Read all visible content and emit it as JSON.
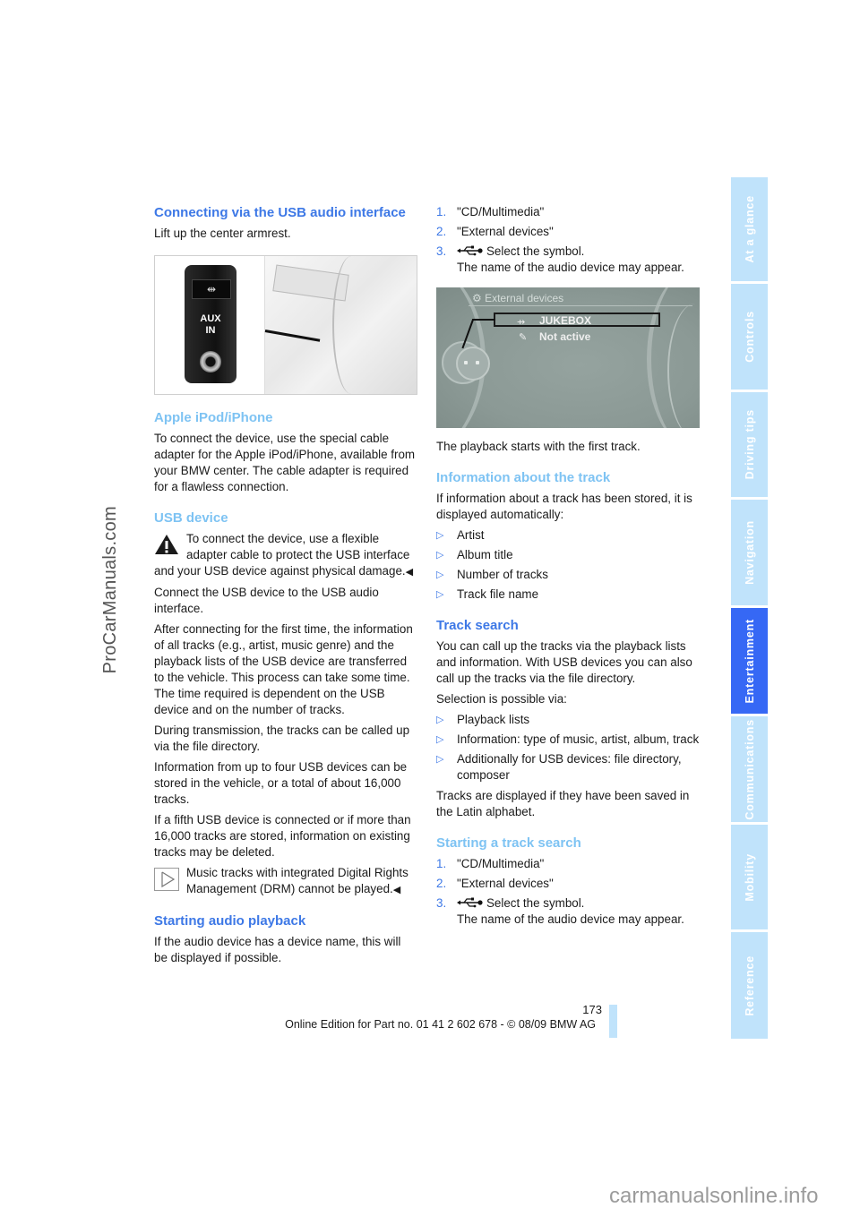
{
  "left_column": {
    "usb_section": {
      "heading": "Connecting via the USB audio interface",
      "intro": "Lift up the center armrest.",
      "figure": {
        "label_line1": "AUX",
        "label_line2": "IN",
        "usb_symbol": "⇹"
      }
    },
    "apple_section": {
      "heading": "Apple iPod/iPhone",
      "body": "To connect the device, use the special cable adapter for the Apple iPod/iPhone, available from your BMW center. The cable adapter is required for a flawless connection."
    },
    "usb_device_section": {
      "heading": "USB device",
      "warning_text": "To connect the device, use a flexible adapter cable to protect the USB interface and your USB device against physical damage.",
      "end_mark": "◀",
      "para1": "Connect the USB device to the USB audio interface.",
      "para2": "After connecting for the first time, the information of all tracks (e.g., artist, music genre) and the playback lists of the USB device are transferred to the vehicle. This process can take some time. The time required is dependent on the USB device and on the number of tracks.",
      "para3": "During transmission, the tracks can be called up via the file directory.",
      "para4": "Information from up to four USB devices can be stored in the vehicle, or a total of about 16,000 tracks.",
      "para5": "If a fifth USB device is connected or if more than 16,000 tracks are stored, information on existing tracks may be deleted.",
      "note_text": "Music tracks with integrated Digital Rights Management (DRM) cannot be played.",
      "note_end_mark": "◀"
    },
    "starting_playback": {
      "heading": "Starting audio playback",
      "body": "If the audio device has a device name, this will be displayed if possible."
    }
  },
  "right_column": {
    "steps": [
      {
        "num": "1.",
        "text": "\"CD/Multimedia\""
      },
      {
        "num": "2.",
        "text": "\"External devices\""
      },
      {
        "num": "3.",
        "text": "Select the symbol.",
        "subtext": "The name of the audio device may appear."
      }
    ],
    "screen": {
      "title": "External devices",
      "items": [
        {
          "icon": "usb-icon",
          "label": "JUKEBOX",
          "selected": true
        },
        {
          "icon": "pen-icon",
          "label": "Not active",
          "selected": false
        }
      ]
    },
    "after_screen": "The playback starts with the first track.",
    "track_info": {
      "heading": "Information about the track",
      "body": "If information about a track has been stored, it is displayed automatically:",
      "bullets": [
        "Artist",
        "Album title",
        "Number of tracks",
        "Track file name"
      ]
    },
    "track_search": {
      "heading": "Track search",
      "body": "You can call up the tracks via the playback lists and information. With USB devices you can also call up the tracks via the file directory.",
      "selection_intro": "Selection is possible via:",
      "bullets": [
        "Playback lists",
        "Information: type of music, artist, album, track",
        "Additionally for USB devices: file directory, composer"
      ],
      "note": "Tracks are displayed if they have been saved in the Latin alphabet."
    },
    "starting_search": {
      "heading": "Starting a track search",
      "steps": [
        {
          "num": "1.",
          "text": "\"CD/Multimedia\""
        },
        {
          "num": "2.",
          "text": "\"External devices\""
        },
        {
          "num": "3.",
          "text": "Select the symbol.",
          "subtext": "The name of the audio device may appear."
        }
      ]
    }
  },
  "side_tabs": [
    {
      "label": "At a glance",
      "active": false
    },
    {
      "label": "Controls",
      "active": false
    },
    {
      "label": "Driving tips",
      "active": false
    },
    {
      "label": "Navigation",
      "active": false
    },
    {
      "label": "Entertainment",
      "active": true
    },
    {
      "label": "Communications",
      "active": false
    },
    {
      "label": "Mobility",
      "active": false
    },
    {
      "label": "Reference",
      "active": false
    }
  ],
  "footer": {
    "page_number": "173",
    "edition": "Online Edition for Part no. 01 41 2 602 678 - © 08/09 BMW AG"
  },
  "watermarks": {
    "left": "ProCarManuals.com",
    "bottom": "carmanualsonline.info"
  },
  "colors": {
    "heading_dark": "#3d78e6",
    "heading_light": "#7ec3f3",
    "tab_inactive": "#c0e3fb",
    "tab_active": "#3668f5"
  }
}
